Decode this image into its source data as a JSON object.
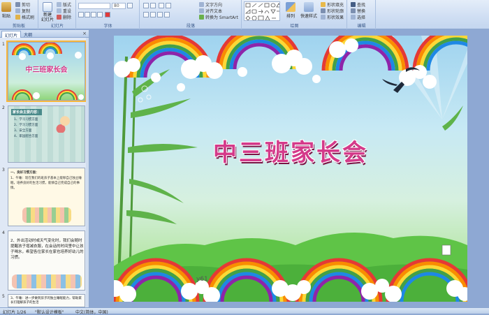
{
  "ribbon": {
    "clipboard": {
      "paste": "粘贴",
      "cut": "剪切",
      "copy": "复制",
      "format_painter": "格式刷",
      "label": "剪贴板"
    },
    "slides": {
      "new_slide": "新建\n幻灯片",
      "layout": "版式",
      "reset": "重设",
      "delete": "删除",
      "label": "幻灯片"
    },
    "font": {
      "font_name": "",
      "font_size": "80",
      "label": "字体"
    },
    "paragraph": {
      "text_direction": "文字方向",
      "align_text": "对齐文本",
      "smartart": "转换为 SmartArt",
      "label": "段落"
    },
    "drawing": {
      "arrange": "排列",
      "quick_styles": "快速样式",
      "shape_fill": "形状填充",
      "shape_outline": "形状轮廓",
      "shape_effects": "形状效果",
      "label": "绘图"
    },
    "editing": {
      "find": "查找",
      "replace": "替换",
      "select": "选择",
      "label": "编辑"
    }
  },
  "pane": {
    "tab_slides": "幻灯片",
    "tab_outline": "大纲",
    "close": "×",
    "thumbs": [
      {
        "num": "1",
        "title": "中三班家长会"
      },
      {
        "num": "2",
        "heading": "家长会主要内容：",
        "items": [
          "1、学习习惯方面",
          "2、学习习惯方面",
          "3、安全方面",
          "4、家园配合方面"
        ]
      },
      {
        "num": "3",
        "heading": "一、良好习惯方面：",
        "text": "1、午睡：现在我们的班孩子基本上能够自己独立睡眠，培养良好的生活习惯，能够自己完成自己的事情。"
      },
      {
        "num": "4",
        "text": "2、外出活动时或天气变化时，我们会随时提醒孩子增减衣服，在会话的时间里中让孩子喝水，希望各位家长在家也培养好幼儿的习惯。"
      },
      {
        "num": "5",
        "text": "3、午睡：进一步做到孩子的独立睡眠能力，帮助家长们理解孩子的生活"
      }
    ]
  },
  "slide": {
    "title": "中三班家长会",
    "watermark": "y61"
  },
  "status": {
    "slide_info": "幻灯片 1/26",
    "theme": "\"默认设计模板\"",
    "language": "中文(简体，中国)"
  },
  "colors": {
    "ribbon_bg": "#cfdef3",
    "title": "#d43a8a",
    "sky": "#9fd3ef",
    "grass": "#8fd67a",
    "selected_outline": "#f7b73c"
  }
}
